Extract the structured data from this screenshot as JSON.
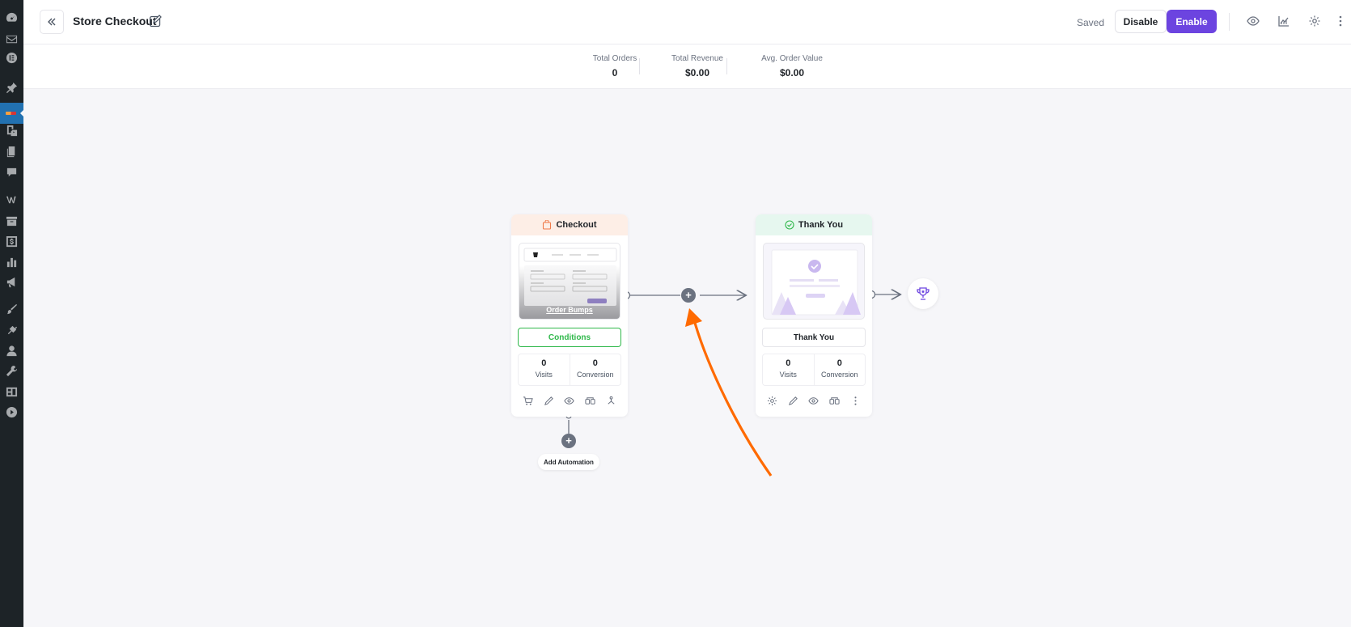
{
  "header": {
    "title": "Store Checkout",
    "status": "Saved",
    "disable_label": "Disable",
    "enable_label": "Enable"
  },
  "stats": {
    "total_orders_label": "Total Orders",
    "total_orders": "0",
    "total_revenue_label": "Total Revenue",
    "total_revenue": "$0.00",
    "avg_order_label": "Avg. Order Value",
    "avg_order": "$0.00"
  },
  "steps": {
    "checkout": {
      "title": "Checkout",
      "preview_label": "Order Bumps",
      "conditions_label": "Conditions",
      "visits": "0",
      "visits_label": "Visits",
      "conversion": "0",
      "conversion_label": "Conversion"
    },
    "thankyou": {
      "title": "Thank You",
      "name_label": "Thank You",
      "visits": "0",
      "visits_label": "Visits",
      "conversion": "0",
      "conversion_label": "Conversion"
    }
  },
  "automation": {
    "add_label": "Add Automation"
  },
  "colors": {
    "accent": "#6c44e0",
    "conditions": "#2fb84a",
    "annotation_arrow": "#ff6a00"
  },
  "icons": [
    "dashboard-icon",
    "mail-icon",
    "elementor-icon",
    "pin-icon",
    "funnelkit-icon",
    "media-icon",
    "pages-icon",
    "comments-icon",
    "woocommerce-icon",
    "products-icon",
    "payments-icon",
    "analytics-icon",
    "marketing-icon",
    "appearance-icon",
    "plugins-icon",
    "users-icon",
    "tools-icon",
    "settings-icon",
    "play-icon"
  ]
}
